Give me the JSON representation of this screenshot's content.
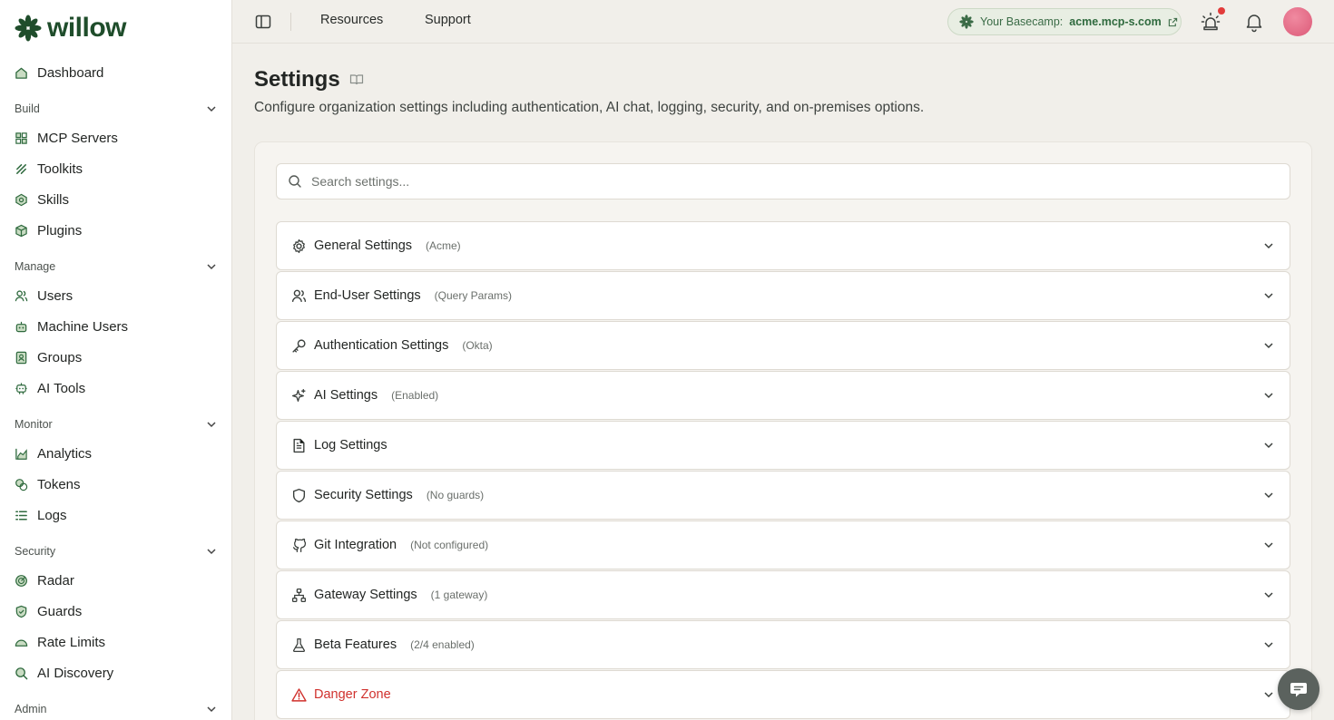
{
  "brand": {
    "name": "willow"
  },
  "sidebar": {
    "top": {
      "label": "Dashboard",
      "icon": "home-icon"
    },
    "sections": [
      {
        "label": "Build",
        "items": [
          {
            "label": "MCP Servers",
            "icon": "mcp-servers-icon"
          },
          {
            "label": "Toolkits",
            "icon": "toolkits-icon"
          },
          {
            "label": "Skills",
            "icon": "skills-icon"
          },
          {
            "label": "Plugins",
            "icon": "plugins-icon"
          }
        ]
      },
      {
        "label": "Manage",
        "items": [
          {
            "label": "Users",
            "icon": "users-icon"
          },
          {
            "label": "Machine Users",
            "icon": "robot-icon"
          },
          {
            "label": "Groups",
            "icon": "groups-icon"
          },
          {
            "label": "AI Tools",
            "icon": "ai-tools-icon"
          }
        ]
      },
      {
        "label": "Monitor",
        "items": [
          {
            "label": "Analytics",
            "icon": "analytics-icon"
          },
          {
            "label": "Tokens",
            "icon": "tokens-icon"
          },
          {
            "label": "Logs",
            "icon": "logs-icon"
          }
        ]
      },
      {
        "label": "Security",
        "items": [
          {
            "label": "Radar",
            "icon": "radar-icon"
          },
          {
            "label": "Guards",
            "icon": "shield-icon"
          },
          {
            "label": "Rate Limits",
            "icon": "gauge-icon"
          },
          {
            "label": "AI Discovery",
            "icon": "search-icon"
          }
        ]
      },
      {
        "label": "Admin",
        "items": []
      }
    ]
  },
  "topbar": {
    "links": [
      "Resources",
      "Support"
    ],
    "basecamp": {
      "label": "Your Basecamp:",
      "domain": "acme.mcp-s.com"
    }
  },
  "page": {
    "title": "Settings",
    "description": "Configure organization settings including authentication, AI chat, logging, security, and on-premises options."
  },
  "search": {
    "placeholder": "Search settings..."
  },
  "settings": [
    {
      "title": "General Settings",
      "sub": "(Acme)",
      "icon": "gear-icon"
    },
    {
      "title": "End-User Settings",
      "sub": "(Query Params)",
      "icon": "users-icon"
    },
    {
      "title": "Authentication Settings",
      "sub": "(Okta)",
      "icon": "key-icon"
    },
    {
      "title": "AI Settings",
      "sub": "(Enabled)",
      "icon": "sparkles-icon"
    },
    {
      "title": "Log Settings",
      "sub": "",
      "icon": "file-text-icon"
    },
    {
      "title": "Security Settings",
      "sub": "(No guards)",
      "icon": "shield-icon"
    },
    {
      "title": "Git Integration",
      "sub": "(Not configured)",
      "icon": "github-icon"
    },
    {
      "title": "Gateway Settings",
      "sub": "(1 gateway)",
      "icon": "network-icon"
    },
    {
      "title": "Beta Features",
      "sub": "(2/4 enabled)",
      "icon": "flask-icon"
    },
    {
      "title": "Danger Zone",
      "sub": "",
      "icon": "warning-icon"
    }
  ],
  "colors": {
    "accent": "#2f6a3e",
    "danger": "#d0312d",
    "notification": "#e23b3b"
  }
}
